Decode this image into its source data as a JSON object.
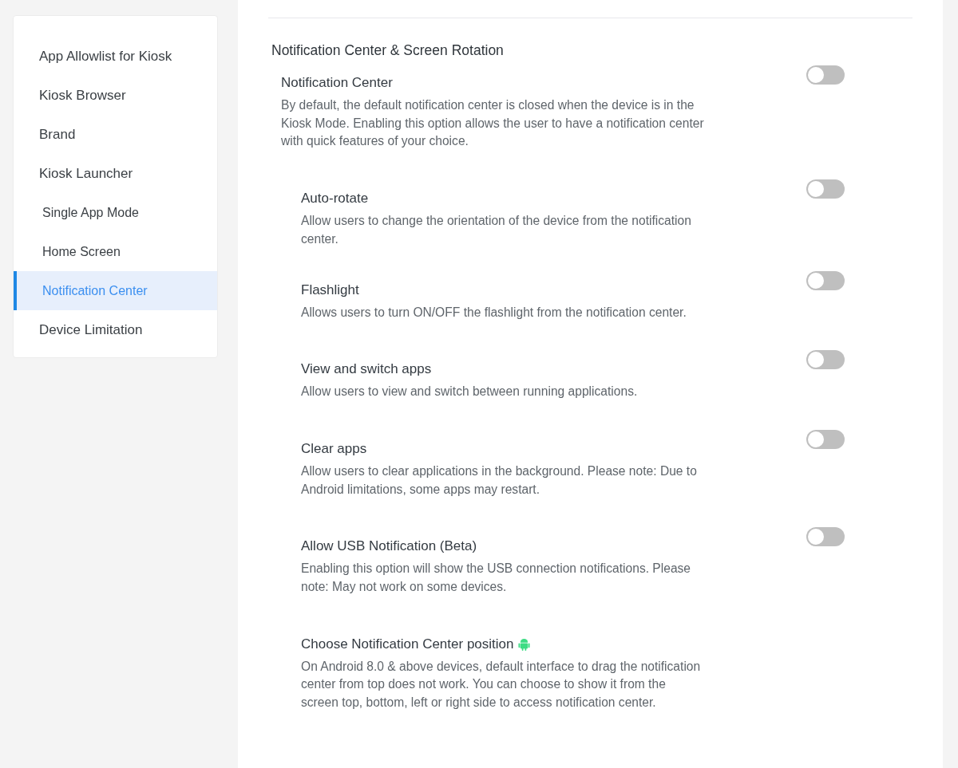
{
  "sidebar": {
    "items": [
      {
        "label": "App Allowlist for Kiosk",
        "selected": false
      },
      {
        "label": "Kiosk Browser",
        "selected": false
      },
      {
        "label": "Brand",
        "selected": false
      },
      {
        "label": "Kiosk Launcher",
        "selected": false,
        "children": [
          {
            "label": "Single App Mode",
            "selected": false
          },
          {
            "label": "Home Screen",
            "selected": false
          },
          {
            "label": "Notification Center",
            "selected": true
          }
        ]
      },
      {
        "label": "Device Limitation",
        "selected": false
      }
    ]
  },
  "section": {
    "title": "Notification Center & Screen Rotation",
    "main": {
      "title": "Notification Center",
      "description": "By default, the default notification center is closed when the device is in the Kiosk Mode. Enabling this option allows the user to have a notification center with quick features of your choice.",
      "on": false
    },
    "options": [
      {
        "kind": "toggle",
        "title": "Auto-rotate",
        "description": "Allow users to change the orientation of the device from the notification center.",
        "on": false
      },
      {
        "kind": "toggle",
        "title": "Flashlight",
        "description": "Allows users to turn ON/OFF the flashlight from the notification center.",
        "on": false
      },
      {
        "kind": "toggle",
        "title": "View and switch apps",
        "description": "Allow users to view and switch between running applications.",
        "on": false
      },
      {
        "kind": "toggle",
        "title": "Clear apps",
        "description": "Allow users to clear applications in the background. Please note: Due to Android limitations, some apps may restart.",
        "on": false
      },
      {
        "kind": "toggle",
        "title": "Allow USB Notification (Beta)",
        "description": "Enabling this option will show the USB connection notifications. Please note: May not work on some devices.",
        "on": false
      },
      {
        "kind": "android",
        "title": "Choose Notification Center position",
        "description": "On Android 8.0 & above devices, default interface to drag the notification center from top does not work. You can choose to show it from the screen top, bottom, left or right side to access notification center."
      }
    ]
  }
}
